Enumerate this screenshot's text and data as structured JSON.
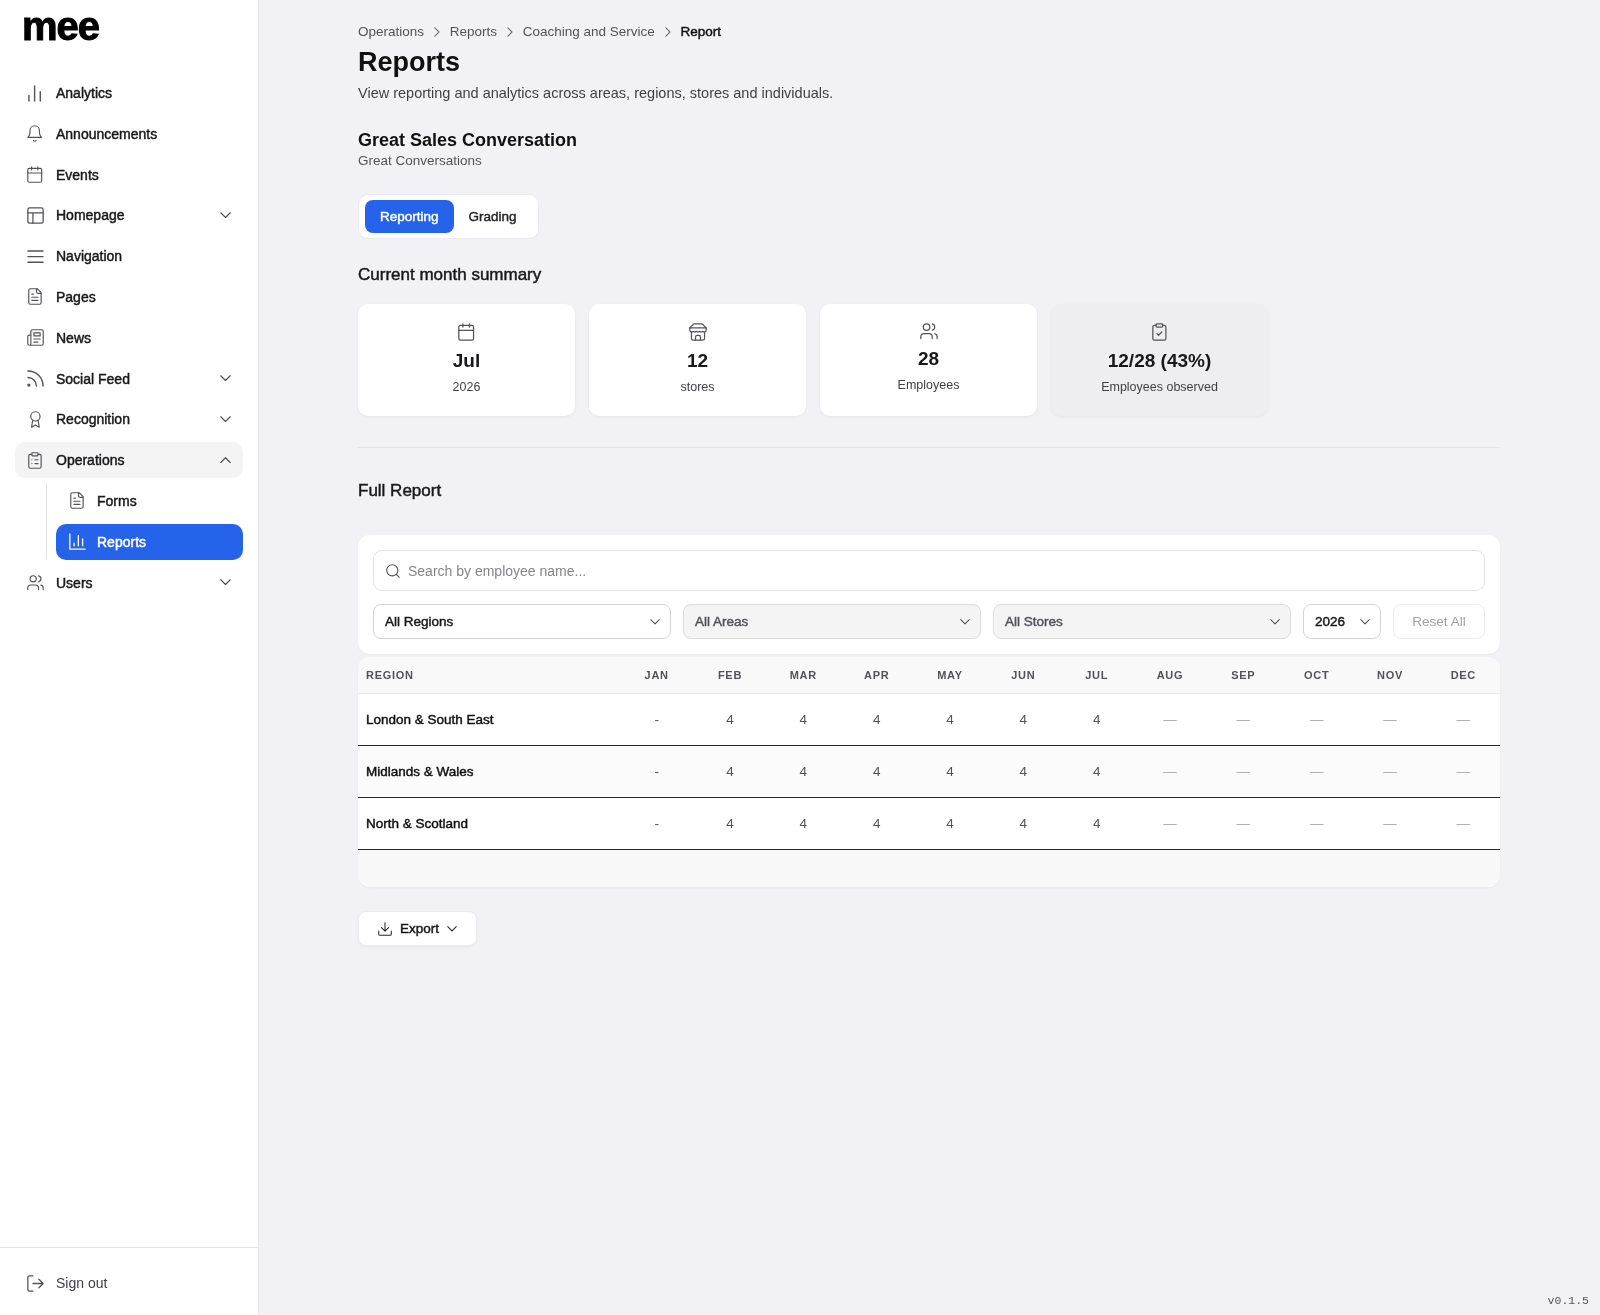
{
  "sidebar": {
    "logo": "mee",
    "items": [
      {
        "label": "Analytics",
        "selected": false
      },
      {
        "label": "Announcements",
        "selected": false
      },
      {
        "label": "Events",
        "selected": false
      },
      {
        "label": "Homepage",
        "selected": false,
        "expanded": false
      },
      {
        "label": "Navigation",
        "selected": false
      },
      {
        "label": "Pages",
        "selected": false
      },
      {
        "label": "News",
        "selected": false
      },
      {
        "label": "Social Feed",
        "selected": false,
        "expanded": false
      },
      {
        "label": "Recognition",
        "selected": false,
        "expanded": false
      },
      {
        "label": "Operations",
        "selected": false,
        "expanded": true,
        "children": [
          {
            "label": "Forms",
            "selected": false
          },
          {
            "label": "Reports",
            "selected": true
          }
        ]
      },
      {
        "label": "Users",
        "selected": false,
        "expanded": false
      }
    ],
    "sign_out": "Sign out"
  },
  "breadcrumb": [
    {
      "label": "Operations",
      "current": false
    },
    {
      "label": "Reports",
      "current": false
    },
    {
      "label": "Coaching and Service",
      "current": false
    },
    {
      "label": "Report",
      "current": true
    }
  ],
  "page": {
    "title": "Reports",
    "subtitle": "View reporting and analytics across areas, regions, stores and individuals."
  },
  "report": {
    "title": "Great Sales Conversation",
    "subtitle": "Great Conversations"
  },
  "tabs": [
    {
      "label": "Reporting",
      "selected": true
    },
    {
      "label": "Grading",
      "selected": false
    }
  ],
  "summary": {
    "title": "Current month summary",
    "cards": [
      {
        "value": "Jul",
        "caption": "2026",
        "highlighted": false
      },
      {
        "value": "12",
        "caption": "stores",
        "highlighted": false
      },
      {
        "value": "28",
        "caption": "Employees",
        "highlighted": false
      },
      {
        "value": "12/28 (43%)",
        "caption": "Employees observed",
        "highlighted": true
      }
    ]
  },
  "full_report": {
    "title": "Full Report",
    "search": {
      "placeholder": "Search by employee name..."
    },
    "filters": [
      {
        "value": "All Regions",
        "disabled": false
      },
      {
        "value": "All Areas",
        "disabled": true
      },
      {
        "value": "All Stores",
        "disabled": true
      },
      {
        "value": "2026",
        "disabled": false
      }
    ],
    "reset": {
      "label": "Reset All",
      "disabled": true
    },
    "table": {
      "columns": [
        {
          "label": "REGION",
          "future": false
        },
        {
          "label": "JAN",
          "future": false
        },
        {
          "label": "FEB",
          "future": false
        },
        {
          "label": "MAR",
          "future": false
        },
        {
          "label": "APR",
          "future": false
        },
        {
          "label": "MAY",
          "future": false
        },
        {
          "label": "JUN",
          "future": false
        },
        {
          "label": "JUL",
          "future": false
        },
        {
          "label": "AUG",
          "future": true
        },
        {
          "label": "SEP",
          "future": true
        },
        {
          "label": "OCT",
          "future": true
        },
        {
          "label": "NOV",
          "future": true
        },
        {
          "label": "DEC",
          "future": true
        }
      ],
      "rows": [
        {
          "cells": [
            "London & South East",
            "-",
            "4",
            "4",
            "4",
            "4",
            "4",
            "4",
            "—",
            "—",
            "—",
            "—",
            "—"
          ]
        },
        {
          "cells": [
            "Midlands & Wales",
            "-",
            "4",
            "4",
            "4",
            "4",
            "4",
            "4",
            "—",
            "—",
            "—",
            "—",
            "—"
          ]
        },
        {
          "cells": [
            "North & Scotland",
            "-",
            "4",
            "4",
            "4",
            "4",
            "4",
            "4",
            "—",
            "—",
            "—",
            "—",
            "—"
          ]
        }
      ]
    }
  },
  "export": {
    "label": "Export"
  },
  "version": "v0.1.5"
}
